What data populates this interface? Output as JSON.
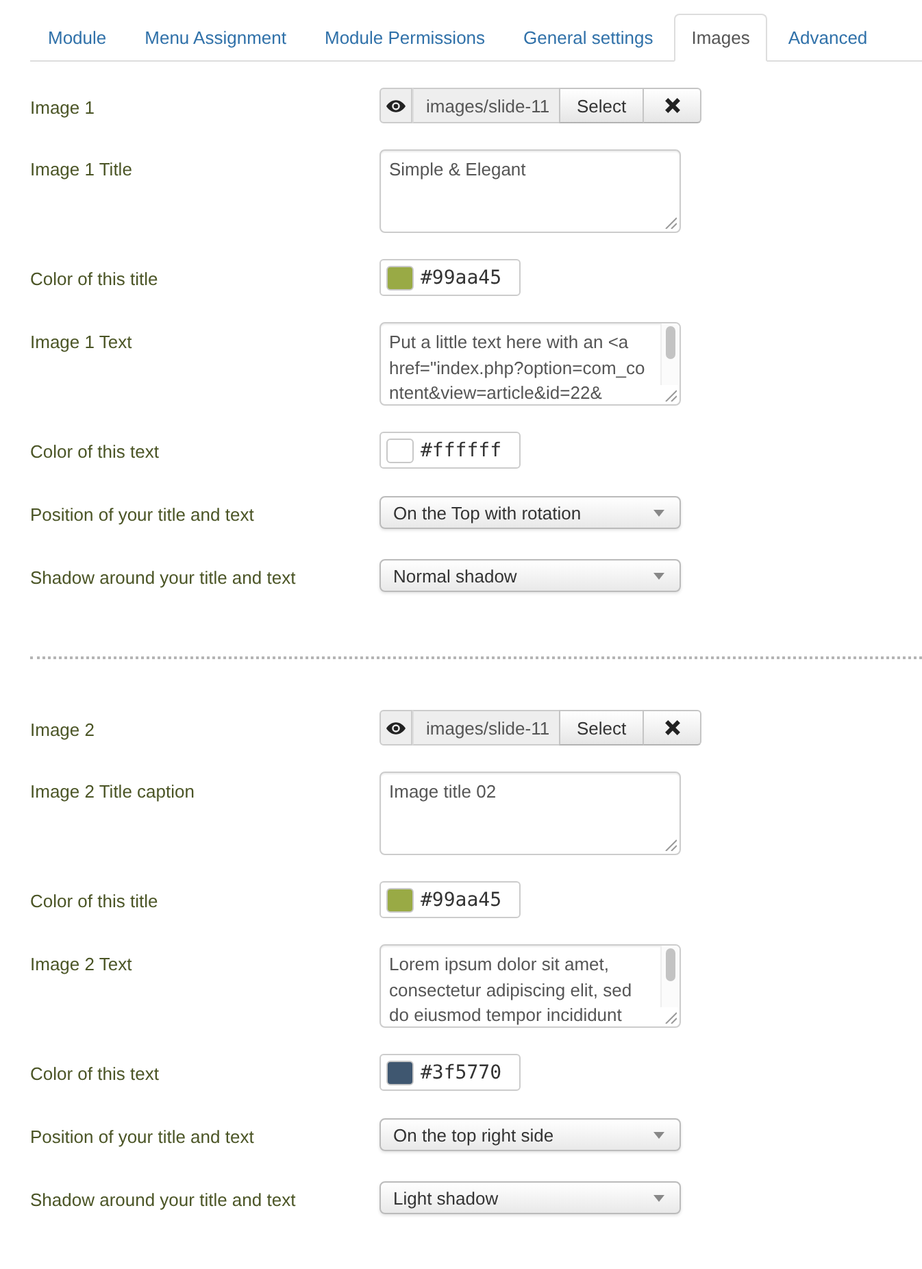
{
  "tabs": [
    {
      "label": "Module",
      "selected": false
    },
    {
      "label": "Menu Assignment",
      "selected": false
    },
    {
      "label": "Module Permissions",
      "selected": false
    },
    {
      "label": "General settings",
      "selected": false
    },
    {
      "label": "Images",
      "selected": true
    },
    {
      "label": "Advanced",
      "selected": false
    }
  ],
  "sections": [
    {
      "fields": [
        {
          "kind": "media",
          "label": "Image 1",
          "value": "images/slide-11",
          "button": "Select"
        },
        {
          "kind": "textarea",
          "label": "Image 1 Title",
          "value": "Simple & Elegant"
        },
        {
          "kind": "color",
          "label": "Color of this title",
          "value": "#99aa45",
          "color": "#99aa45"
        },
        {
          "kind": "textarea",
          "label": "Image 1 Text",
          "value": "Put a little text here with an <a href=\"index.php?option=com_content&view=article&id=22&"
        },
        {
          "kind": "color",
          "label": "Color of this text",
          "value": "#ffffff",
          "color": "#ffffff"
        },
        {
          "kind": "select",
          "label": "Position of your title and text",
          "value": "On the Top with rotation"
        },
        {
          "kind": "select",
          "label": "Shadow around your title and text",
          "value": "Normal shadow"
        }
      ]
    },
    {
      "fields": [
        {
          "kind": "media",
          "label": "Image 2",
          "value": "images/slide-11",
          "button": "Select"
        },
        {
          "kind": "textarea",
          "label": "Image 2 Title caption",
          "value": "Image title 02"
        },
        {
          "kind": "color",
          "label": "Color of this title",
          "value": "#99aa45",
          "color": "#99aa45"
        },
        {
          "kind": "textarea",
          "label": "Image 2 Text",
          "value": "Lorem ipsum dolor sit amet, consectetur adipiscing elit, sed do eiusmod tempor incididunt"
        },
        {
          "kind": "color",
          "label": "Color of this text",
          "value": "#3f5770",
          "color": "#3f5770"
        },
        {
          "kind": "select",
          "label": "Position of your title and text",
          "value": "On the top right side"
        },
        {
          "kind": "select",
          "label": "Shadow around your title and text",
          "value": "Light shadow"
        }
      ]
    }
  ]
}
